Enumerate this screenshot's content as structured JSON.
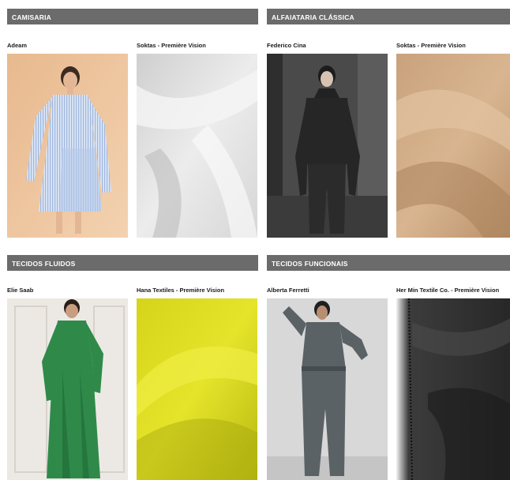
{
  "sections": [
    {
      "title": "CAMISARIA",
      "items": [
        {
          "caption": "Adeam",
          "image": "model-striped-shirt-dress"
        },
        {
          "caption": "Soktas - Première Vision",
          "image": "white-cotton-fabric"
        }
      ]
    },
    {
      "title": "ALFAIATARIA CLÁSSICA",
      "items": [
        {
          "caption": "Federico Cina",
          "image": "model-dark-tailored-suit"
        },
        {
          "caption": "Soktas - Première Vision",
          "image": "beige-twill-fabric"
        }
      ]
    },
    {
      "title": "TECIDOS FLUIDOS",
      "items": [
        {
          "caption": "Elie Saab",
          "image": "model-green-flowing-dress"
        },
        {
          "caption": "Hana Textiles - Première Vision",
          "image": "chartreuse-fluid-fabric"
        }
      ]
    },
    {
      "title": "TECIDOS FUNCIONAIS",
      "items": [
        {
          "caption": "Alberta Ferretti",
          "image": "model-grey-utility-jumpsuit"
        },
        {
          "caption": "Her Min Textile Co. - Première Vision",
          "image": "black-technical-fabric"
        }
      ]
    }
  ],
  "colors": {
    "header_bg": "#6b6b6b",
    "header_text": "#ffffff"
  }
}
